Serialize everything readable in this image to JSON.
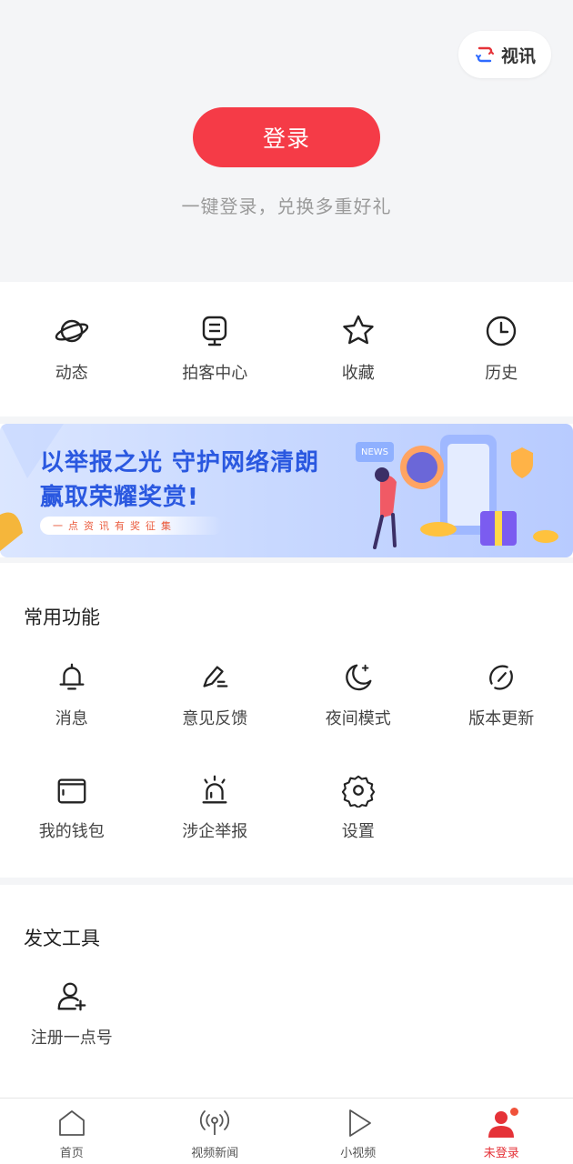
{
  "header": {
    "video_chip_label": "视讯",
    "login_button": "登录",
    "login_subtitle": "一键登录，兑换多重好礼"
  },
  "quick_actions": [
    {
      "label": "动态",
      "icon": "planet-icon"
    },
    {
      "label": "拍客中心",
      "icon": "camera-icon"
    },
    {
      "label": "收藏",
      "icon": "star-icon"
    },
    {
      "label": "历史",
      "icon": "clock-icon"
    }
  ],
  "banner": {
    "line1": "以举报之光  守护网络清朗",
    "line2": "赢取荣耀奖赏!",
    "tag": "一点资讯有奖征集",
    "badge": "NEWS"
  },
  "common_functions": {
    "title": "常用功能",
    "items": [
      {
        "label": "消息",
        "icon": "bell-icon"
      },
      {
        "label": "意见反馈",
        "icon": "pencil-icon"
      },
      {
        "label": "夜间模式",
        "icon": "moon-icon"
      },
      {
        "label": "版本更新",
        "icon": "refresh-icon"
      },
      {
        "label": "我的钱包",
        "icon": "wallet-icon"
      },
      {
        "label": "涉企举报",
        "icon": "alarm-icon"
      },
      {
        "label": "设置",
        "icon": "gear-icon"
      }
    ]
  },
  "publish_tools": {
    "title": "发文工具",
    "items": [
      {
        "label": "注册一点号",
        "icon": "add-user-icon"
      }
    ]
  },
  "tabbar": {
    "items": [
      {
        "label": "首页",
        "icon": "home-icon"
      },
      {
        "label": "视频新闻",
        "icon": "broadcast-icon"
      },
      {
        "label": "小视频",
        "icon": "play-icon"
      },
      {
        "label": "未登录",
        "icon": "user-icon"
      }
    ]
  },
  "colors": {
    "accent_red": "#f53b47",
    "banner_blue": "#2a58e0",
    "page_bg": "#f4f5f7"
  }
}
